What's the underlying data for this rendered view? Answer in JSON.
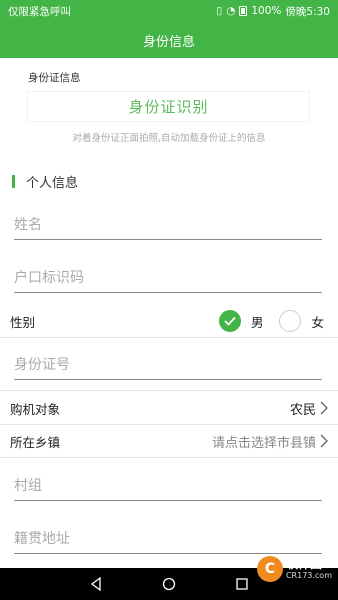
{
  "status_bar": {
    "left_text": "仅限紧急呼叫",
    "battery": "100%",
    "time": "傍晚5:30"
  },
  "header": {
    "title": "身份信息"
  },
  "id_card": {
    "title": "身份证信息",
    "recognize_label": "身份证识别",
    "hint": "对着身份证正面拍照,自动加载身份证上的信息"
  },
  "personal": {
    "section_title": "个人信息",
    "name_placeholder": "姓名",
    "hukou_placeholder": "户口标识码",
    "gender_label": "性别",
    "gender_options": [
      "男",
      "女"
    ],
    "gender_selected": "男",
    "idno_placeholder": "身份证号",
    "buyer_label": "购机对象",
    "buyer_value": "农民",
    "town_label": "所在乡镇",
    "town_placeholder": "请点击选择市县镇",
    "village_placeholder": "村组",
    "address_placeholder": "籍贯地址"
  },
  "watermark": {
    "name": "软件园",
    "sub": "CR173.com"
  }
}
